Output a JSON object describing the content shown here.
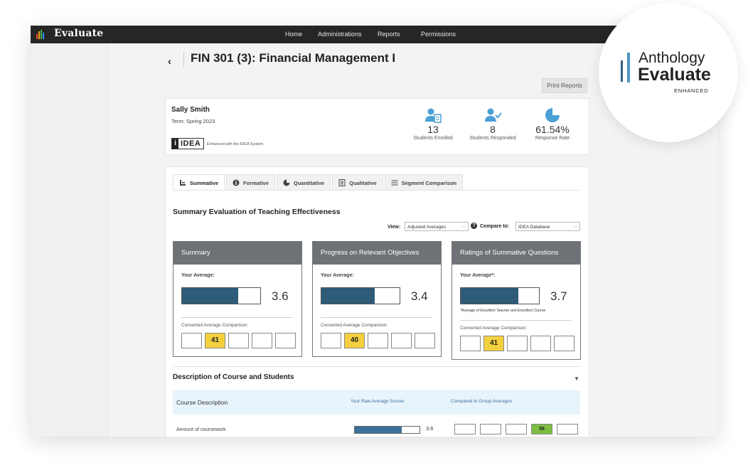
{
  "app": {
    "title": "Evaluate",
    "logo_colors": [
      "#e84a27",
      "#f3a712",
      "#4caf50",
      "#2196f3"
    ]
  },
  "nav": {
    "items": [
      "Home",
      "Administrations",
      "Reports",
      "Permissions"
    ]
  },
  "page": {
    "back_glyph": "‹",
    "title": "FIN 301 (3): Financial Management I",
    "print_button": "Print Reports"
  },
  "course_info": {
    "instructor": "Sally Smith",
    "term": "Term: Spring 2023",
    "idea_logo_i": "i",
    "idea_logo_word": "IDEA",
    "idea_tagline": "Enhanced with the IDEA System",
    "stats": [
      {
        "icon": "students-enrolled-icon",
        "value": "13",
        "label": "Students Enrolled"
      },
      {
        "icon": "students-responded-icon",
        "value": "8",
        "label": "Students Responded"
      },
      {
        "icon": "response-rate-pie-icon",
        "value": "61.54%",
        "label": "Response Rate"
      }
    ]
  },
  "tabs": [
    {
      "label": "Summative",
      "icon": "bar-chart-icon",
      "active": true
    },
    {
      "label": "Formative",
      "icon": "info-icon",
      "active": false
    },
    {
      "label": "Quantitative",
      "icon": "pie-chart-icon",
      "active": false
    },
    {
      "label": "Qualitative",
      "icon": "document-icon",
      "active": false
    },
    {
      "label": "Segment Comparison",
      "icon": "sliders-icon",
      "active": false
    }
  ],
  "summary_section": {
    "title": "Summary Evaluation of Teaching Effectiveness",
    "view_label": "View:",
    "view_value": "Adjusted Averages",
    "compare_label": "Compare to:",
    "compare_value": "IDEA Database",
    "help_glyph": "?"
  },
  "panels": [
    {
      "title": "Summary",
      "your_average_label": "Your Average:",
      "average": "3.6",
      "fill": 0.72,
      "note": "",
      "conv_label": "Converted Average Comparison:",
      "boxes": [
        "",
        "41",
        "",
        "",
        ""
      ],
      "highlight": 1
    },
    {
      "title": "Progress on Relevant Objectives",
      "your_average_label": "Your Average:",
      "average": "3.4",
      "fill": 0.68,
      "note": "",
      "conv_label": "Converted Average Comparison:",
      "boxes": [
        "",
        "40",
        "",
        "",
        ""
      ],
      "highlight": 1
    },
    {
      "title": "Ratings of Summative Questions",
      "your_average_label": "Your Average*:",
      "average": "3.7",
      "fill": 0.74,
      "note": "*Average of Excellent Teacher and Excellent Course",
      "conv_label": "Converted Average Comparison:",
      "boxes": [
        "",
        "41",
        "",
        "",
        ""
      ],
      "highlight": 1
    }
  ],
  "description": {
    "title": "Description of Course and Students",
    "header_label": "Course Description",
    "col_raw": "Your Raw Average Scores",
    "col_compared": "Compared to Group Averages",
    "rows": [
      {
        "label": "Amount of coursework",
        "value": "3.6",
        "fill": 0.72,
        "boxes": [
          "",
          "",
          "",
          "56",
          ""
        ],
        "highlight": 3
      }
    ]
  },
  "badge": {
    "line1": "Anthology",
    "line2": "Evaluate",
    "line3": "ENHANCED"
  },
  "colors": {
    "accent_bar": "#2e5b78",
    "highlight_yellow": "#f4d03f",
    "highlight_green": "#7cbd42",
    "panel_header": "#6e7276"
  }
}
